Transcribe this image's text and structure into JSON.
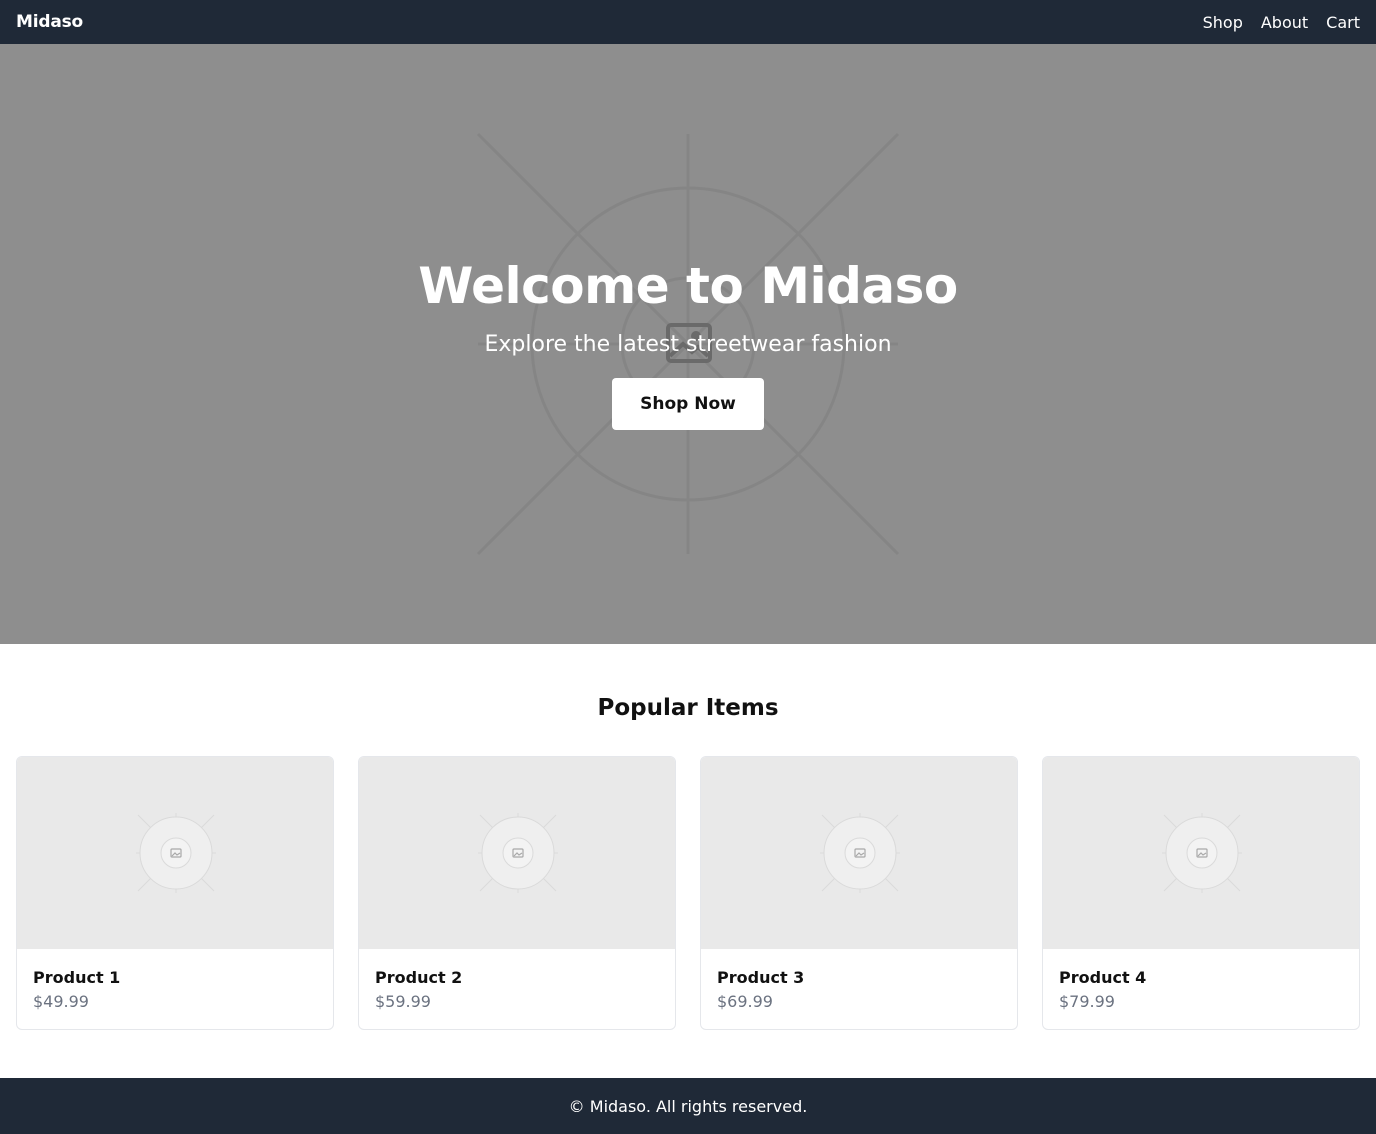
{
  "navbar": {
    "brand": "Midaso",
    "links": [
      {
        "label": "Shop"
      },
      {
        "label": "About"
      },
      {
        "label": "Cart"
      }
    ]
  },
  "hero": {
    "title": "Welcome to Midaso",
    "subtitle": "Explore the latest streetwear fashion",
    "cta_label": "Shop Now",
    "background_color": "#8e8e8e"
  },
  "popular": {
    "title": "Popular Items",
    "products": [
      {
        "name": "Product 1",
        "price": "$49.99",
        "image_icon": "image-placeholder-icon"
      },
      {
        "name": "Product 2",
        "price": "$59.99",
        "image_icon": "image-placeholder-icon"
      },
      {
        "name": "Product 3",
        "price": "$69.99",
        "image_icon": "image-placeholder-icon"
      },
      {
        "name": "Product 4",
        "price": "$79.99",
        "image_icon": "image-placeholder-icon"
      }
    ]
  },
  "footer": {
    "text": "© Midaso. All rights reserved."
  },
  "colors": {
    "nav_bg": "#1f2937",
    "footer_bg": "#1f2937",
    "price_text": "#6b7280",
    "card_border": "#e5e7eb"
  }
}
